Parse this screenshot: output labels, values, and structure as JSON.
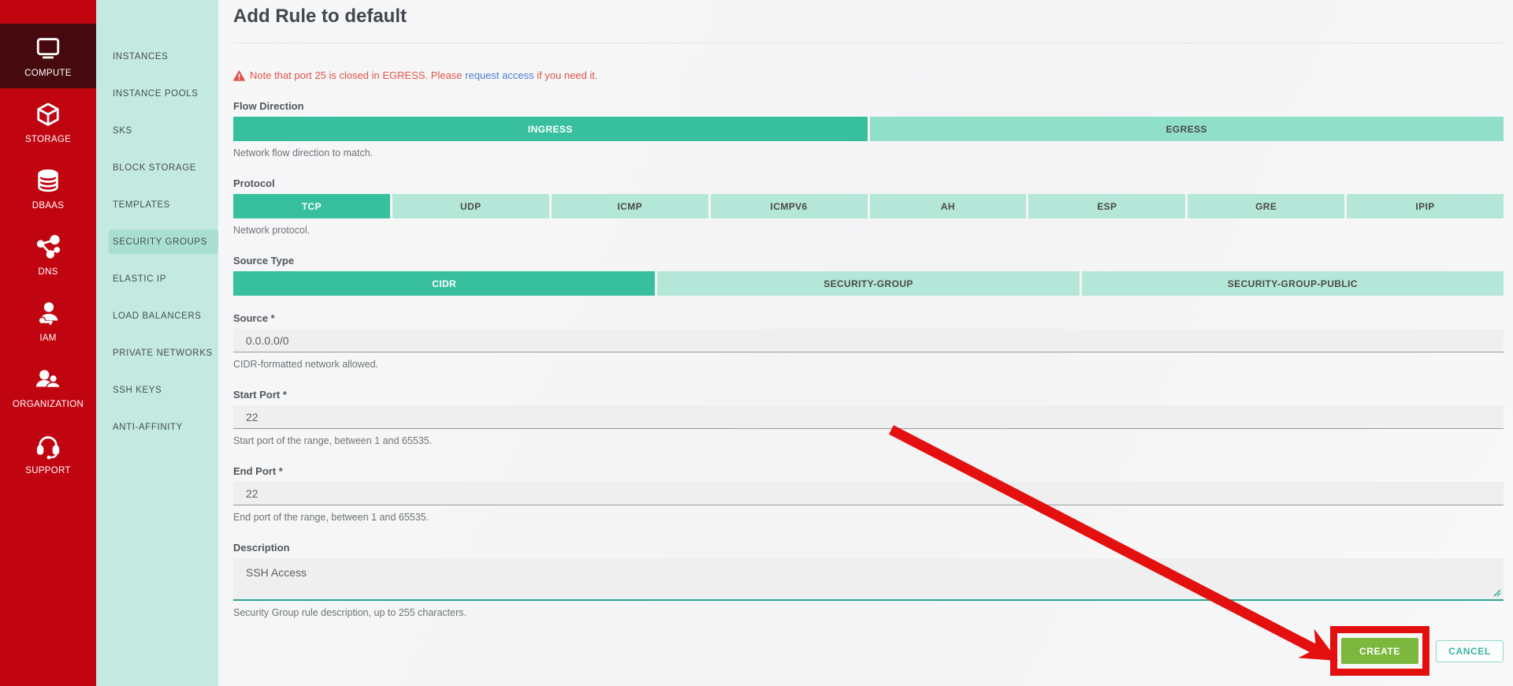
{
  "page": {
    "title": "Add Rule to default",
    "warning": {
      "text_before_link": "Note that port 25 is closed in EGRESS. Please ",
      "link_text": "request access",
      "text_after_link": " if you need it."
    }
  },
  "primary_nav": {
    "items": [
      {
        "label": "COMPUTE",
        "icon": "monitor-icon",
        "active": true
      },
      {
        "label": "STORAGE",
        "icon": "cube-icon",
        "active": false
      },
      {
        "label": "DBAAS",
        "icon": "database-icon",
        "active": false
      },
      {
        "label": "DNS",
        "icon": "network-nodes-icon",
        "active": false
      },
      {
        "label": "IAM",
        "icon": "user-key-icon",
        "active": false
      },
      {
        "label": "ORGANIZATION",
        "icon": "users-icon",
        "active": false
      },
      {
        "label": "SUPPORT",
        "icon": "headset-icon",
        "active": false
      }
    ]
  },
  "secondary_nav": {
    "items": [
      {
        "label": "INSTANCES",
        "selected": false
      },
      {
        "label": "INSTANCE POOLS",
        "selected": false
      },
      {
        "label": "SKS",
        "selected": false
      },
      {
        "label": "BLOCK STORAGE",
        "selected": false
      },
      {
        "label": "TEMPLATES",
        "selected": false
      },
      {
        "label": "SECURITY GROUPS",
        "selected": true
      },
      {
        "label": "ELASTIC IP",
        "selected": false
      },
      {
        "label": "LOAD BALANCERS",
        "selected": false
      },
      {
        "label": "PRIVATE NETWORKS",
        "selected": false
      },
      {
        "label": "SSH KEYS",
        "selected": false
      },
      {
        "label": "ANTI-AFFINITY",
        "selected": false
      }
    ]
  },
  "form": {
    "flow_direction": {
      "label": "Flow Direction",
      "options": [
        "INGRESS",
        "EGRESS"
      ],
      "selected": "INGRESS",
      "helper": "Network flow direction to match."
    },
    "protocol": {
      "label": "Protocol",
      "options": [
        "TCP",
        "UDP",
        "ICMP",
        "ICMPV6",
        "AH",
        "ESP",
        "GRE",
        "IPIP"
      ],
      "selected": "TCP",
      "helper": "Network protocol."
    },
    "source_type": {
      "label": "Source Type",
      "options": [
        "CIDR",
        "SECURITY-GROUP",
        "SECURITY-GROUP-PUBLIC"
      ],
      "selected": "CIDR"
    },
    "source": {
      "label": "Source *",
      "value": "0.0.0.0/0",
      "helper": "CIDR-formatted network allowed."
    },
    "start_port": {
      "label": "Start Port *",
      "value": "22",
      "helper": "Start port of the range, between 1 and 65535."
    },
    "end_port": {
      "label": "End Port *",
      "value": "22",
      "helper": "End port of the range, between 1 and 65535."
    },
    "description": {
      "label": "Description",
      "value": "SSH Access",
      "helper": "Security Group rule description, up to 255 characters."
    },
    "actions": {
      "create": "CREATE",
      "cancel": "CANCEL"
    }
  },
  "colors": {
    "accent_teal": "#38c09e",
    "mint_medium": "#90dfc8",
    "mint_light": "#b4e7d8",
    "sidebar_red": "#c00511",
    "sidebar_red_active": "#460a0e",
    "sidebar_teal": "#c3e9e0",
    "sidebar_teal_selected": "#a9dfd3",
    "warning_red": "#e0544a",
    "link_blue": "#4c7fd0",
    "create_green": "#7cb83e",
    "cancel_teal": "#3cb3a4",
    "annotation_red": "#e40f0f",
    "textarea_focus_teal": "#2aa793"
  }
}
